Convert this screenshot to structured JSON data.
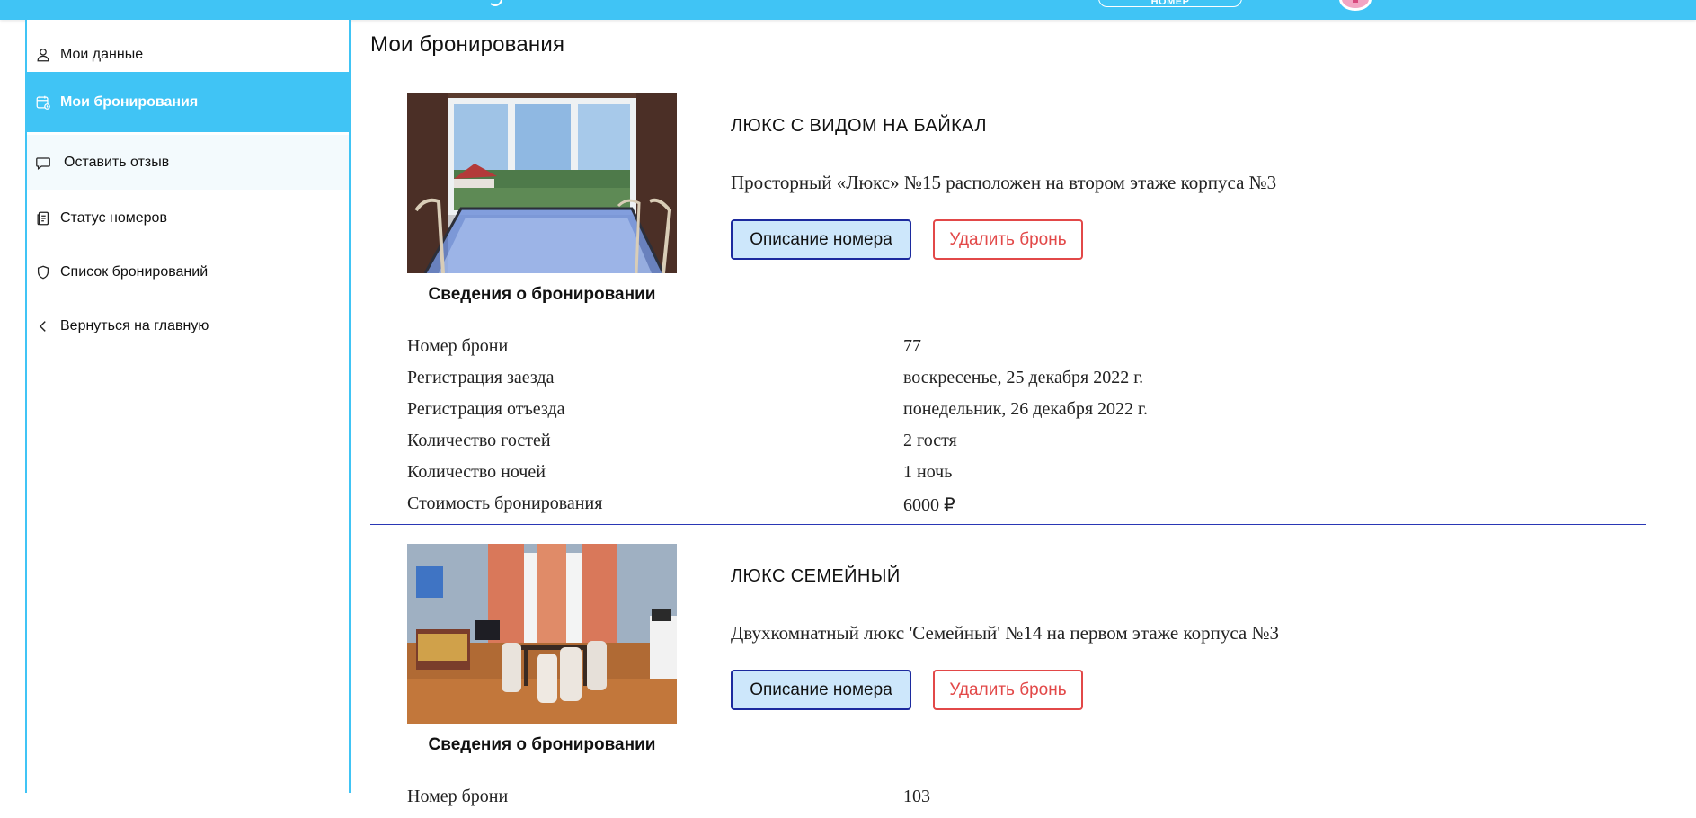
{
  "header": {
    "nav_button_label": "НОМЕР"
  },
  "sidebar": {
    "items": [
      {
        "label": "Мои данные",
        "icon": "user-icon"
      },
      {
        "label": "Мои бронирования",
        "icon": "calendar-icon",
        "active": true
      },
      {
        "label": "Оставить отзыв",
        "icon": "chat-icon"
      },
      {
        "label": "Статус номеров",
        "icon": "document-icon"
      },
      {
        "label": "Список бронирований",
        "icon": "shield-icon"
      },
      {
        "label": "Вернуться на главную",
        "icon": "chevron-left-icon"
      }
    ]
  },
  "main": {
    "title": "Мои бронирования",
    "bookings": [
      {
        "room_name": "ЛЮКС С ВИДОМ НА БАЙКАЛ",
        "description": "Просторный «Люкс» №15 расположен на втором этаже корпуса №3",
        "describe_button": "Описание номера",
        "delete_button": "Удалить бронь",
        "info_title": "Сведения о бронировании",
        "rows": [
          {
            "label": "Номер брони",
            "value": "77"
          },
          {
            "label": "Регистрация заезда",
            "value": "воскресенье, 25 декабря 2022 г."
          },
          {
            "label": "Регистрация отъезда",
            "value": "понедельник, 26 декабря 2022 г."
          },
          {
            "label": "Количество гостей",
            "value": "2 гостя"
          },
          {
            "label": "Количество ночей",
            "value": "1 ночь"
          },
          {
            "label": "Стоимость бронирования",
            "value": "6000 ₽"
          }
        ]
      },
      {
        "room_name": "ЛЮКС СЕМЕЙНЫЙ",
        "description": "Двухкомнатный люкс 'Семейный' №14 на первом этаже корпуса №3",
        "describe_button": "Описание номера",
        "delete_button": "Удалить бронь",
        "info_title": "Сведения о бронировании",
        "rows": [
          {
            "label": "Номер брони",
            "value": "103"
          }
        ]
      }
    ]
  },
  "colors": {
    "accent": "#40c4f5",
    "primary_button_bg": "#cde7fb",
    "primary_button_border": "#1c2a9e",
    "danger": "#e24848",
    "divider": "#2a37b5"
  }
}
